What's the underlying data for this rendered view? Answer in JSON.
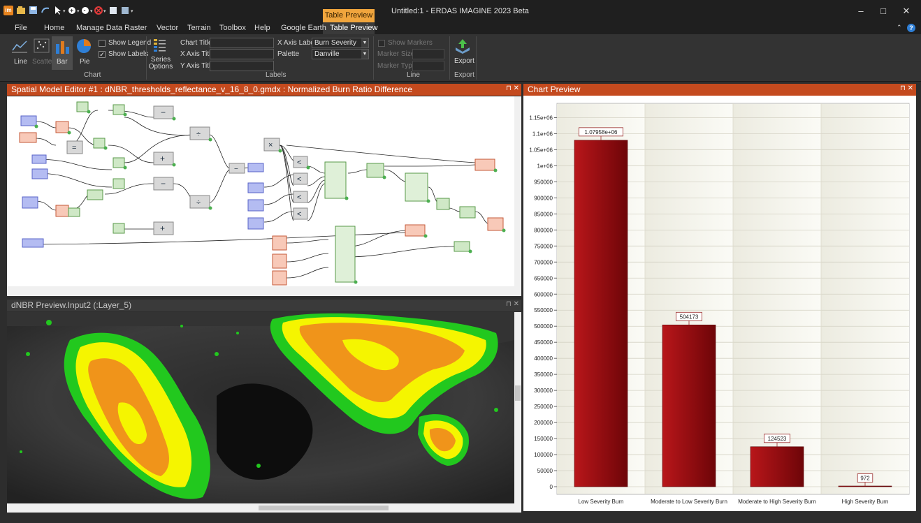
{
  "window": {
    "title": "Untitled:1 - ERDAS IMAGINE 2023 Beta",
    "context_tab_header": "Table Preview",
    "minimize": "–",
    "maximize": "□",
    "close": "✕"
  },
  "menu": [
    "File",
    "Home",
    "Manage Data",
    "Raster",
    "Vector",
    "Terrain",
    "Toolbox",
    "Help",
    "Google Earth",
    "Table Preview"
  ],
  "ribbon": {
    "chart_types": [
      "Line",
      "Scatter",
      "Bar",
      "Pie"
    ],
    "show_legend": "Show Legend",
    "show_labels": "Show Labels",
    "series_options": "Series Options",
    "group_chart": "Chart",
    "chart_title_label": "Chart Title",
    "x_axis_title_label": "X Axis Title",
    "y_axis_title_label": "Y Axis Title",
    "x_axis_labels_label": "X Axis Labels",
    "x_axis_labels_value": "Burn Severity",
    "palette_label": "Palette",
    "palette_value": "Danville",
    "group_labels": "Labels",
    "show_markers": "Show Markers",
    "marker_size": "Marker Size",
    "marker_type": "Marker Type",
    "group_line": "Line",
    "export_button": "Export",
    "group_export": "Export"
  },
  "panels": {
    "model_editor_title": "Spatial Model Editor #1 : dNBR_thresholds_reflectance_v_16_8_0.gmdx : Normalized Burn Ratio Difference",
    "image_view_title": "dNBR Preview.Input2 (:Layer_5)",
    "chart_title": "Chart Preview",
    "pin": "⊓ ✕"
  },
  "colors": {
    "accent": "#c44a1e",
    "bar_fill": "#9a0c10",
    "burn_yellow": "#f5f500",
    "burn_green": "#22c81e",
    "burn_orange": "#f0941a"
  },
  "chart_data": {
    "type": "bar",
    "categories": [
      "Low Severity Burn",
      "Moderate to Low Severity Burn",
      "Moderate to High Severity Burn",
      "High Severity Burn"
    ],
    "values": [
      1079580,
      504173,
      124523,
      972
    ],
    "data_labels": [
      "1.07958e+06",
      "504173",
      "124523",
      "972"
    ],
    "ylim": [
      0,
      1175000
    ],
    "yticks": [
      0,
      50000,
      100000,
      150000,
      200000,
      250000,
      300000,
      350000,
      400000,
      450000,
      500000,
      550000,
      600000,
      650000,
      700000,
      750000,
      800000,
      850000,
      900000,
      950000,
      1000000,
      1050000,
      1100000,
      1150000
    ],
    "ytick_labels": [
      "0",
      "50000",
      "100000",
      "150000",
      "200000",
      "250000",
      "300000",
      "350000",
      "400000",
      "450000",
      "500000",
      "550000",
      "600000",
      "650000",
      "700000",
      "750000",
      "800000",
      "850000",
      "900000",
      "950000",
      "1e+06",
      "1.05e+06",
      "1.1e+06",
      "1.15e+06"
    ],
    "grid": true,
    "title": "",
    "xlabel": "",
    "ylabel": ""
  }
}
